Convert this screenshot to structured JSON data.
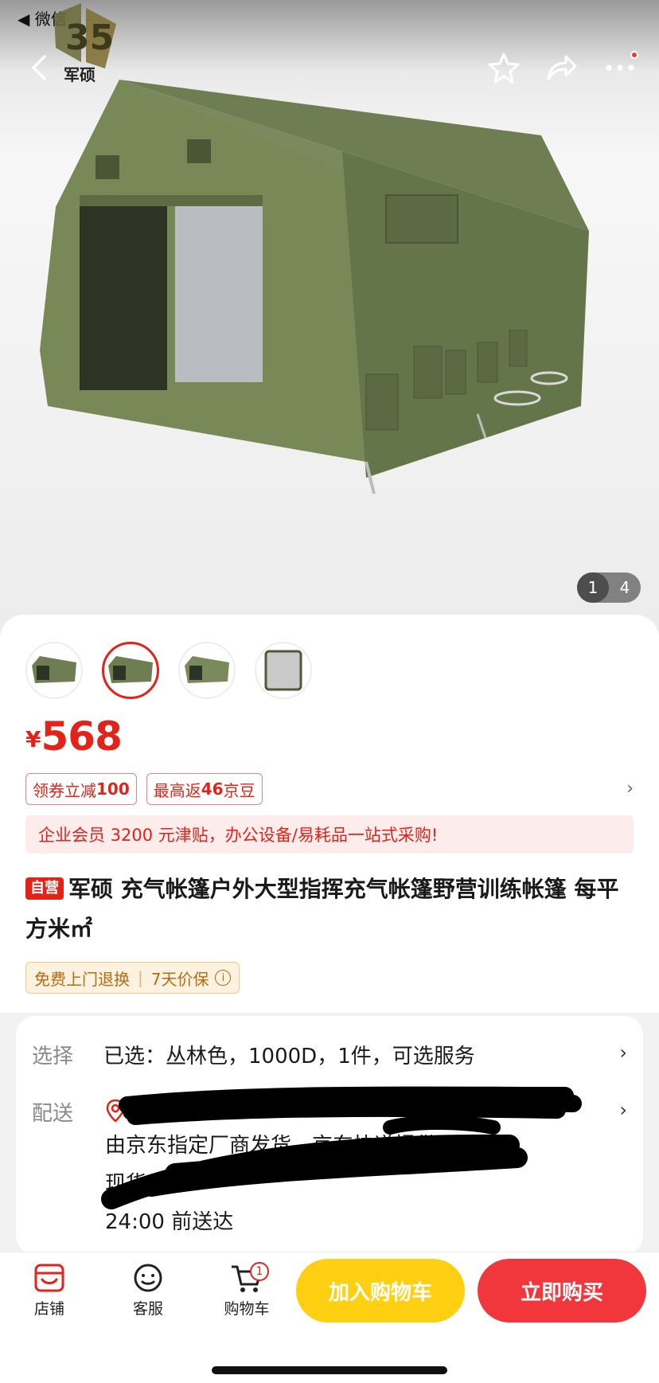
{
  "status_bar": {
    "back_app": "◀ 微信"
  },
  "brand": {
    "logo_text": "军硕"
  },
  "hero": {
    "pager_current": "1",
    "pager_total": "4"
  },
  "price": {
    "currency": "¥",
    "amount": "568"
  },
  "coupons": [
    {
      "prefix": "领券立减",
      "value": "100",
      "suffix": ""
    },
    {
      "prefix": "最高返",
      "value": "46",
      "suffix": "京豆"
    }
  ],
  "banner": "企业会员 3200 元津贴，办公设备/易耗品一站式采购!",
  "product": {
    "badge": "自营",
    "title": "军硕 充气帐篷户外大型指挥充气帐篷野营训练帐篷 每平方米㎡"
  },
  "service": {
    "item1": "免费上门退换",
    "item2": "7天价保",
    "info_icon": "ⓘ"
  },
  "options": {
    "select_label": "选择",
    "select_value": "已选：丛林色，1000D，1件，可选服务",
    "delivery_label": "配送",
    "delivery_lines": [
      "由京东指定厂商发货，京东快递提供配送服务",
      "现货",
      "24:00 前送达"
    ]
  },
  "bottom_bar": {
    "store": "店铺",
    "service": "客服",
    "cart": "购物车",
    "cart_count": "1",
    "add_to_cart": "加入购物车",
    "buy_now": "立即购买"
  },
  "colors": {
    "accent_red": "#e2231a",
    "buy_red": "#f2373c",
    "cart_yellow": "#ffcf11"
  }
}
